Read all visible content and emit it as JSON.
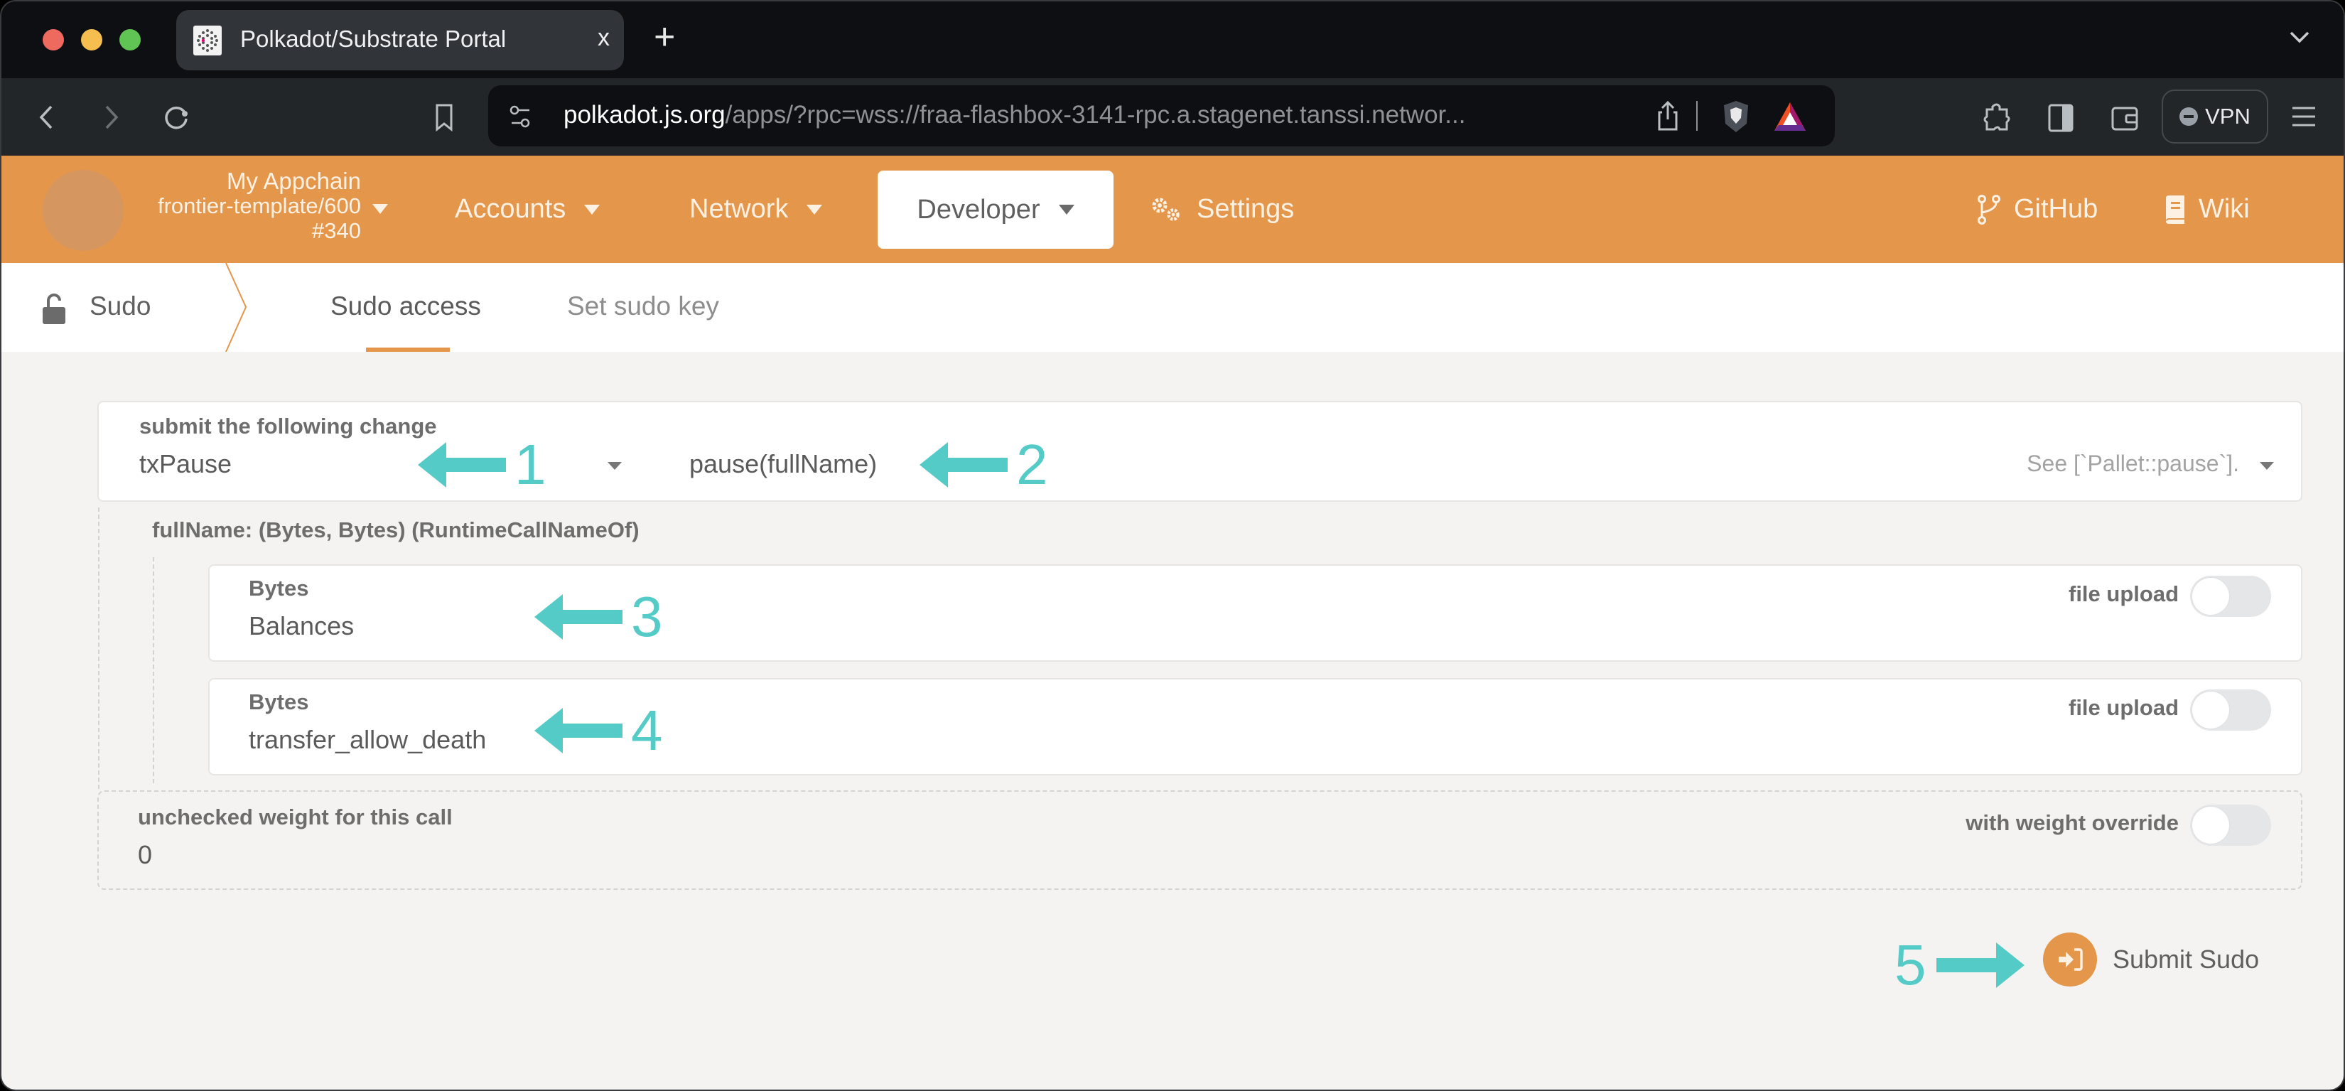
{
  "browser": {
    "tab_title": "Polkadot/Substrate Portal",
    "tab_close": "x",
    "new_tab": "+",
    "url_host": "polkadot.js.org",
    "url_rest": "/apps/?rpc=wss://fraa-flashbox-3141-rpc.a.stagenet.tanssi.networ...",
    "vpn_label": "VPN"
  },
  "header": {
    "chain_name": "My Appchain",
    "chain_spec": "frontier-template/600",
    "chain_block": "#340",
    "menu": {
      "accounts": "Accounts",
      "network": "Network",
      "developer": "Developer",
      "settings": "Settings",
      "github": "GitHub",
      "wiki": "Wiki"
    },
    "accent_color": "#e4964b"
  },
  "subnav": {
    "section": "Sudo",
    "tabs": [
      {
        "label": "Sudo access",
        "active": true
      },
      {
        "label": "Set sudo key",
        "active": false
      }
    ]
  },
  "form": {
    "call_label": "submit the following change",
    "pallet": "txPause",
    "method": "pause(fullName)",
    "method_doc": "See [`Pallet::pause`].",
    "param_label": "fullName: (Bytes, Bytes) (RuntimeCallNameOf)",
    "params": [
      {
        "label": "Bytes",
        "value": "Balances",
        "toggle_label": "file upload",
        "toggle_on": false
      },
      {
        "label": "Bytes",
        "value": "transfer_allow_death",
        "toggle_label": "file upload",
        "toggle_on": false
      }
    ],
    "weight_label": "unchecked weight for this call",
    "weight_value": "0",
    "weight_toggle_label": "with weight override",
    "weight_toggle_on": false,
    "submit_label": "Submit Sudo"
  },
  "annotations": {
    "color": "#55cbc7",
    "labels": [
      "1",
      "2",
      "3",
      "4",
      "5"
    ]
  }
}
